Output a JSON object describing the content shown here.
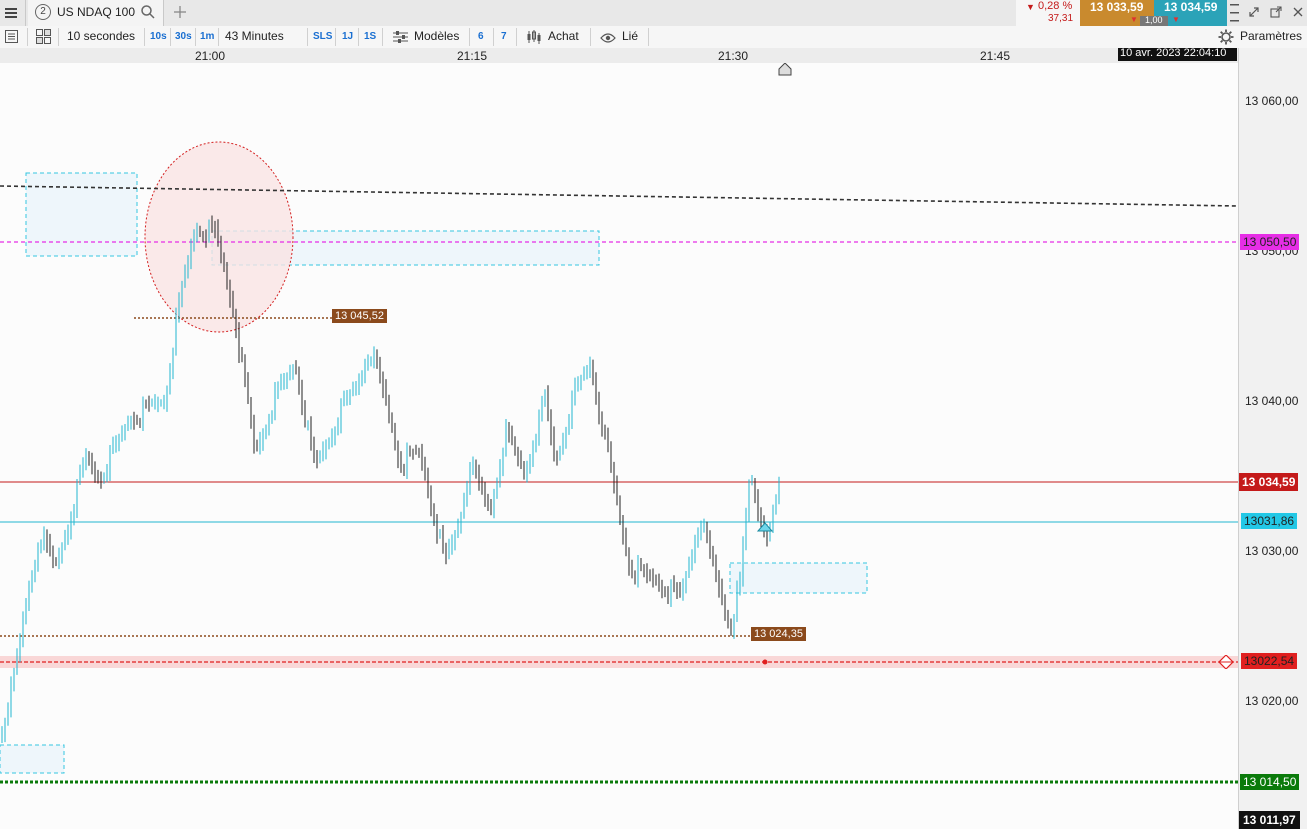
{
  "header": {
    "tab_number": "2",
    "instrument": "US NDAQ 100",
    "change_pct": "0,28 %",
    "change_abs": "37,31",
    "bid": "13 033,59",
    "ask": "13 034,59",
    "qty": "1,00"
  },
  "toolbar": {
    "interval": "10 secondes",
    "q10s": "10s",
    "q30s": "30s",
    "q1m": "1m",
    "duration": "43 Minutes",
    "sls": "SLS",
    "j1": "1J",
    "s1": "1S",
    "models": "Modèles",
    "n6": "6",
    "n7": "7",
    "buy": "Achat",
    "linked": "Lié",
    "settings": "Paramètres"
  },
  "time_axis": {
    "labels": [
      "21:00",
      "21:15",
      "21:30",
      "21:45"
    ],
    "datetime": "10 avr. 2023 22:04:10"
  },
  "price_axis": {
    "labels": [
      "13 060,00",
      "13 050,00",
      "13 040,00",
      "13 030,00",
      "13 020,00"
    ],
    "current": "13 034,59",
    "cyan_level": "13031,86",
    "magenta_level": "13 050,50",
    "red_level": "13022,54",
    "green_level": "13 014,50",
    "bottom": "13 011,97"
  },
  "chart_labels": {
    "high_tag": "13 045,52",
    "low_tag": "13 024,35"
  },
  "colors": {
    "bull": "#22b6cf",
    "bear": "#222222",
    "bid_bg": "#c98a2e",
    "ask_bg": "#2ba3b8",
    "current": "#c41a1a",
    "magenta": "#e62ee6",
    "green": "#0a7a0a",
    "brown": "#8b4a1c"
  }
}
